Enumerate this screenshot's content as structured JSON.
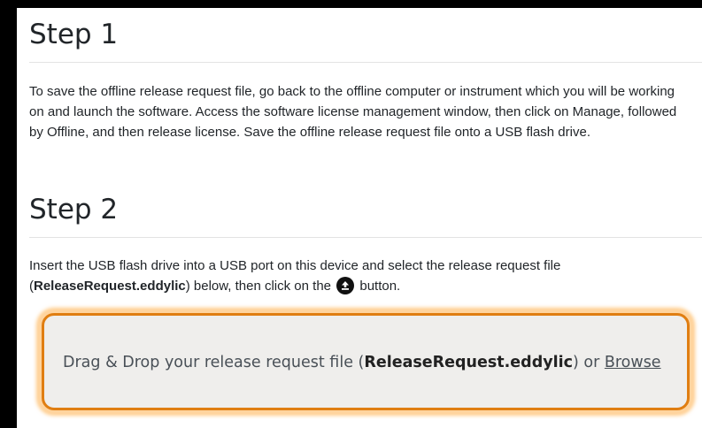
{
  "step1": {
    "heading": "Step 1",
    "text": "To save the offline release request file, go back to the offline computer or instrument which you will be working on and launch the software. Access the software license management window, then click on Manage, followed by Offline, and then release license. Save the offline release request file onto a USB flash drive."
  },
  "step2": {
    "heading": "Step 2",
    "text_before_file": "Insert the USB flash drive into a USB port on this device and select the release request file (",
    "file_name": "ReleaseRequest.eddylic",
    "text_after_file": ") below, then click on the ",
    "upload_icon": "upload-icon",
    "text_end": " button."
  },
  "dropzone": {
    "text_before": "Drag & Drop your release request file (",
    "file_name": "ReleaseRequest.eddylic",
    "text_after": ") or ",
    "browse_label": "Browse",
    "accent_color": "#e07e12"
  }
}
